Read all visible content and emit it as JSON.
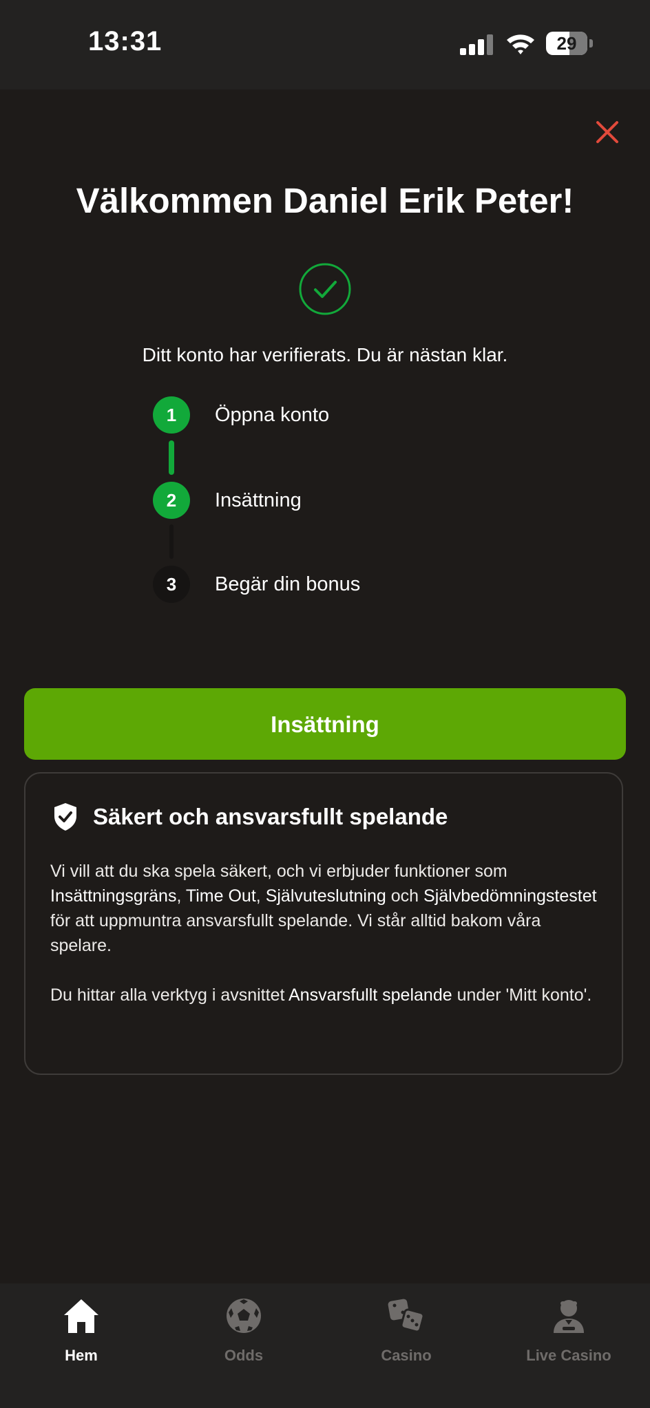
{
  "status_bar": {
    "time": "13:31",
    "battery_percent": "29",
    "battery_level": 0.29,
    "signal_bars": 4,
    "icons": [
      "cellular-signal-icon",
      "wifi-icon",
      "battery-icon"
    ]
  },
  "modal": {
    "close_icon": "close-icon",
    "close_color": "#e24a3b",
    "title": "Välkommen Daniel Erik Peter!",
    "check_icon": "check-circle-icon",
    "verified_text": "Ditt konto har verifierats. Du är nästan klar.",
    "steps": [
      {
        "number": "1",
        "label": "Öppna konto",
        "completed": true
      },
      {
        "number": "2",
        "label": "Insättning",
        "completed": true
      },
      {
        "number": "3",
        "label": "Begär din bonus",
        "completed": false
      }
    ],
    "primary_button_label": "Insättning"
  },
  "info_card": {
    "icon": "shield-check-icon",
    "title": "Säkert och ansvarsfullt spelande",
    "paragraph1": {
      "intro": "Vi vill att du ska spela säkert, och vi erbjuder funktioner som",
      "feature1": "Insättningsgräns",
      "sep1": ",",
      "feature2": "Time Out",
      "sep2": ",",
      "feature3": "Självuteslutning",
      "sep3": "och",
      "feature4": "Självbedömningstestet",
      "outro": "för att uppmuntra ansvarsfullt spelande. Vi står alltid bakom våra spelare."
    },
    "paragraph2": {
      "intro": "Du hittar alla verktyg i avsnittet",
      "highlight": "Ansvarsfullt spelande",
      "outro": "under 'Mitt konto'."
    }
  },
  "tab_bar": {
    "tabs": [
      {
        "label": "Hem",
        "icon": "home-icon",
        "active": true
      },
      {
        "label": "Odds",
        "icon": "soccer-ball-icon",
        "active": false
      },
      {
        "label": "Casino",
        "icon": "dice-icon",
        "active": false
      },
      {
        "label": "Live Casino",
        "icon": "dealer-icon",
        "active": false
      }
    ]
  },
  "colors": {
    "background": "#1e1b19",
    "bars": "#232221",
    "step_green": "#12a93a",
    "button_green": "#5da805",
    "tab_active": "#ffffff",
    "tab_inactive": "#6f6c6a"
  }
}
